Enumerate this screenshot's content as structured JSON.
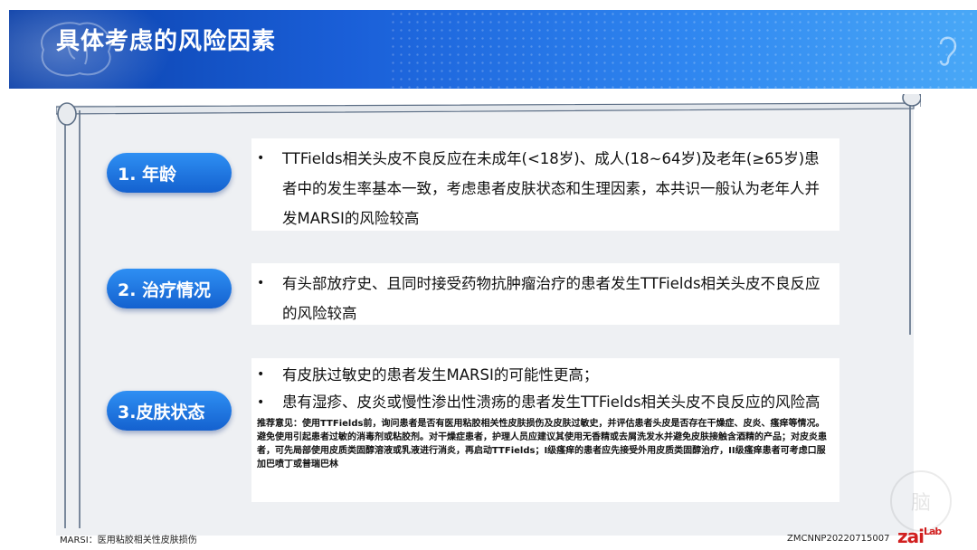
{
  "header": {
    "title": "具体考虑的风险因素"
  },
  "factors": [
    {
      "label": "1. 年龄",
      "bullets": [
        "TTFields相关头皮不良反应在未成年(<18岁)、成人(18~64岁)及老年(≥65岁)患者中的发生率基本一致，考虑患者皮肤状态和生理因素，本共识一般认为老年人并发MARSI的风险较高"
      ]
    },
    {
      "label": "2. 治疗情况",
      "bullets": [
        "有头部放疗史、且同时接受药物抗肿瘤治疗的患者发生TTFields相关头皮不良反应的风险较高"
      ]
    },
    {
      "label": "3.皮肤状态",
      "bullets": [
        "有皮肤过敏史的患者发生MARSI的可能性更高；",
        "患有湿疹、皮炎或慢性渗出性溃疡的患者发生TTFields相关头皮不良反应的风险高"
      ],
      "recommendation": "推荐意见：使用TTFields前，询问患者是否有医用粘胶相关性皮肤损伤及皮肤过敏史，并评估患者头皮是否存在干燥症、皮炎、瘙痒等情况。避免使用引起患者过敏的消毒剂或粘胶剂。对干燥症患者，护理人员应建议其使用无香精或去屑洗发水并避免皮肤接触含酒精的产品；对皮炎患者，可先局部使用皮质类固醇溶液或乳液进行消炎，再启动TTFields；I级瘙痒的患者应先接受外用皮质类固醇治疗，II级瘙痒患者可考虑口服加巴喷丁或普瑞巴林"
    }
  ],
  "footer": {
    "footnote": "MARSI：医用粘胶相关性皮肤损伤",
    "doc_code": "ZMCNNP20220715007",
    "logo_main": "zai",
    "logo_sup": "Lab"
  },
  "colors": {
    "header_start": "#0a3fa8",
    "header_end": "#49a8f7",
    "pill": "#1a6fe0",
    "scroll": "#eef0f3"
  }
}
